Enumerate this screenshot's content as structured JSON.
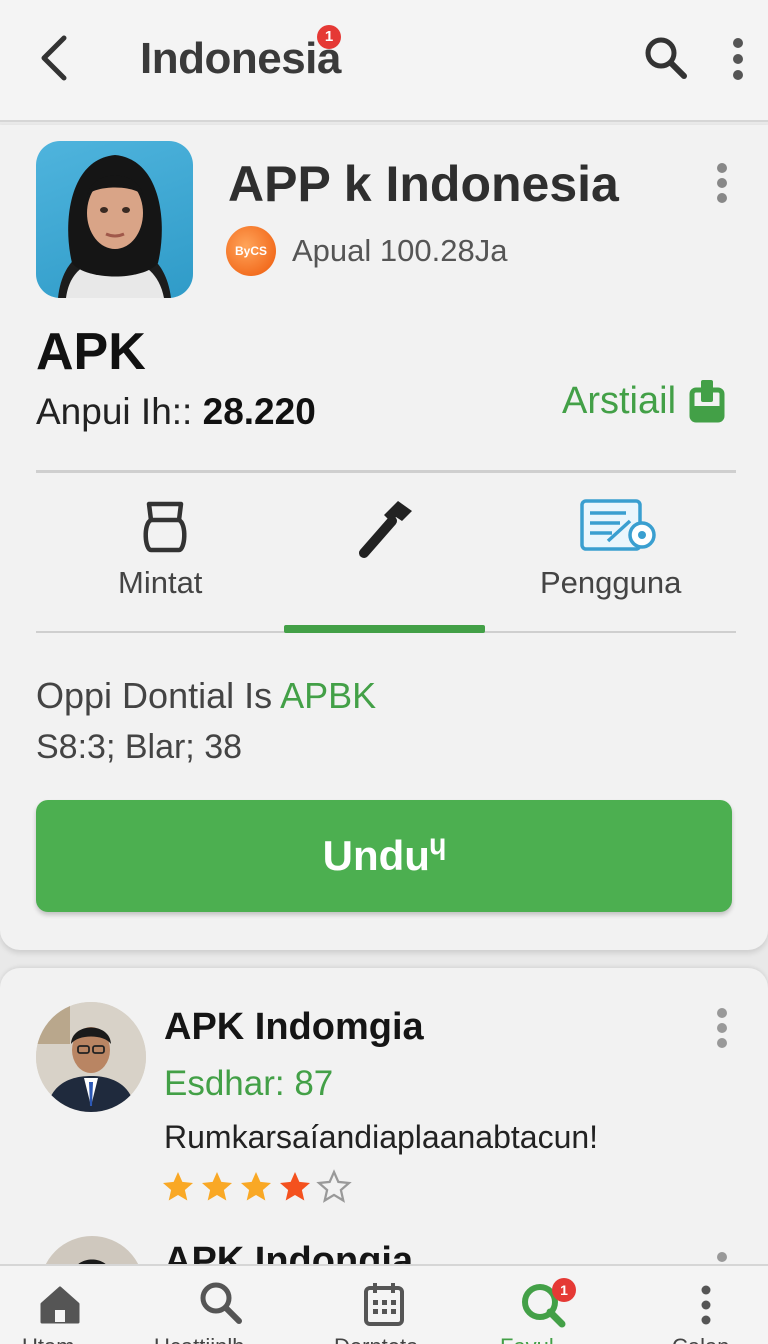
{
  "header": {
    "title": "Indonesia",
    "title_badge": "1",
    "back_icon": "chevron-left-icon",
    "search_icon": "search-icon",
    "menu_icon": "more-vertical-icon"
  },
  "app": {
    "name": "APP k Indonesia",
    "developer_logo_text": "ByCS",
    "developer_text": "Apual 100.28Ja",
    "type_label": "APK",
    "stat_label": "Anpui Ih::",
    "stat_value": "28.220",
    "install_label": "Arstiail",
    "install_icon": "install-icon"
  },
  "tabs": [
    {
      "label": "Mintat",
      "icon": "bag-icon",
      "active": false
    },
    {
      "label": "",
      "icon": "hammer-icon",
      "active": true
    },
    {
      "label": "Pengguna",
      "icon": "document-settings-icon",
      "active": false
    }
  ],
  "info": {
    "headline_prefix": "Oppi Dontial Is ",
    "headline_accent": "APBK",
    "subline": "S8:3; Blar; 38"
  },
  "download_button": "Unduᶣ",
  "review": {
    "name": "APK Indomgia",
    "score": "Esdhar: 87",
    "text": "Rumkarsaíandiaplaanabtacun!",
    "rating": 4,
    "max_rating": 5
  },
  "next_review": {
    "name": "APK Indongia"
  },
  "bottom_nav": [
    {
      "label": "Utam",
      "icon": "home-icon",
      "active": false
    },
    {
      "label": "Ucattjinlh",
      "icon": "search-icon",
      "active": false
    },
    {
      "label": "Dernteta",
      "icon": "calendar-icon",
      "active": false
    },
    {
      "label": "Favul",
      "icon": "search-badge-icon",
      "active": true,
      "badge": "1"
    },
    {
      "label": "Calan",
      "icon": "more-vertical-icon",
      "active": false
    }
  ],
  "colors": {
    "accent": "#43a047",
    "button": "#4caf50",
    "badge": "#e53935",
    "star": "#f9a825"
  }
}
